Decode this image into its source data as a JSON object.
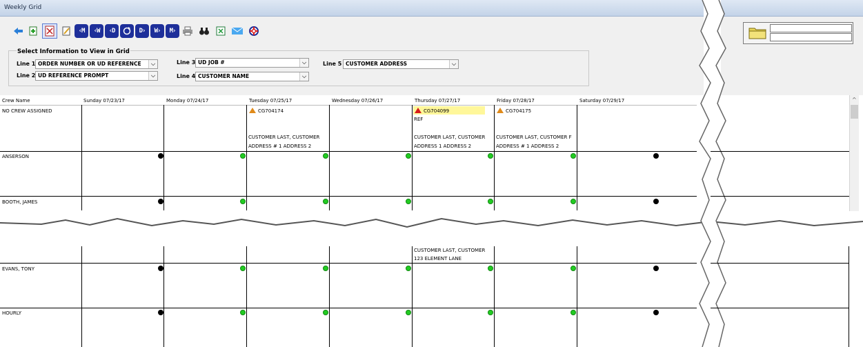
{
  "window": {
    "title": "Weekly Grid"
  },
  "toolbar": {
    "icons": [
      "back-arrow-icon",
      "add-page-icon",
      "print-preview-icon",
      "edit-page-icon",
      "nav-prev-month",
      "nav-prev-week",
      "nav-prev-day",
      "refresh-icon",
      "nav-next-day",
      "nav-next-week",
      "nav-next-month",
      "printer-icon",
      "binoculars-icon",
      "excel-icon",
      "email-icon",
      "help-lifebuoy-icon"
    ],
    "nav_labels": {
      "prev_month": "‹M",
      "prev_week": "‹W",
      "prev_day": "‹D",
      "next_day": "D›",
      "next_week": "W›",
      "next_month": "M›"
    }
  },
  "selector": {
    "title": "Select Information to View in Grid",
    "line1": {
      "label": "Line 1",
      "value": "ORDER NUMBER OR UD REFERENCE"
    },
    "line2": {
      "label": "Line 2",
      "value": "UD REFERENCE PROMPT"
    },
    "line3": {
      "label": "Line 3",
      "value": "UD JOB #"
    },
    "line4": {
      "label": "Line 4",
      "value": "CUSTOMER NAME"
    },
    "line5": {
      "label": "Line 5",
      "value": "CUSTOMER ADDRESS"
    }
  },
  "grid": {
    "crew_header": "Crew Name",
    "days": [
      "Sunday 07/23/17",
      "Monday 07/24/17",
      "Tuesday 07/25/17",
      "Wednesday 07/26/17",
      "Thursday 07/27/17",
      "Friday 07/28/17",
      "Saturday 07/29/17"
    ],
    "rows": [
      {
        "crew": "NO CREW ASSIGNED"
      },
      {
        "crew": "ANSERSON"
      },
      {
        "crew": "BOOTH, JAMES"
      },
      {
        "crew": "EVANS, TONY"
      },
      {
        "crew": "HOURLY"
      }
    ],
    "jobs": {
      "tue": {
        "order": "CG704174",
        "line4": "CUSTOMER LAST, CUSTOMER",
        "line5": "ADDRESS # 1 ADDRESS 2"
      },
      "thu": {
        "order": "CG704099",
        "line2": "REF",
        "line4": "CUSTOMER LAST, CUSTOMER",
        "line5": "ADDRESS 1 ADDRESS 2"
      },
      "fri": {
        "order": "CG704175",
        "line4": "CUSTOMER LAST, CUSTOMER F",
        "line5": "ADDRESS # 1 ADDRESS 2"
      }
    },
    "partial": {
      "line4": "CUSTOMER LAST, CUSTOMER",
      "line5": "123 ELEMENT LANE"
    }
  },
  "colors": {
    "nav_button": "#1e2f9a",
    "available_dot": "#22cc22",
    "unavailable_dot": "#000000",
    "highlight": "#fff79a",
    "warning": "#e08a1a",
    "alert": "#d81b1b"
  }
}
